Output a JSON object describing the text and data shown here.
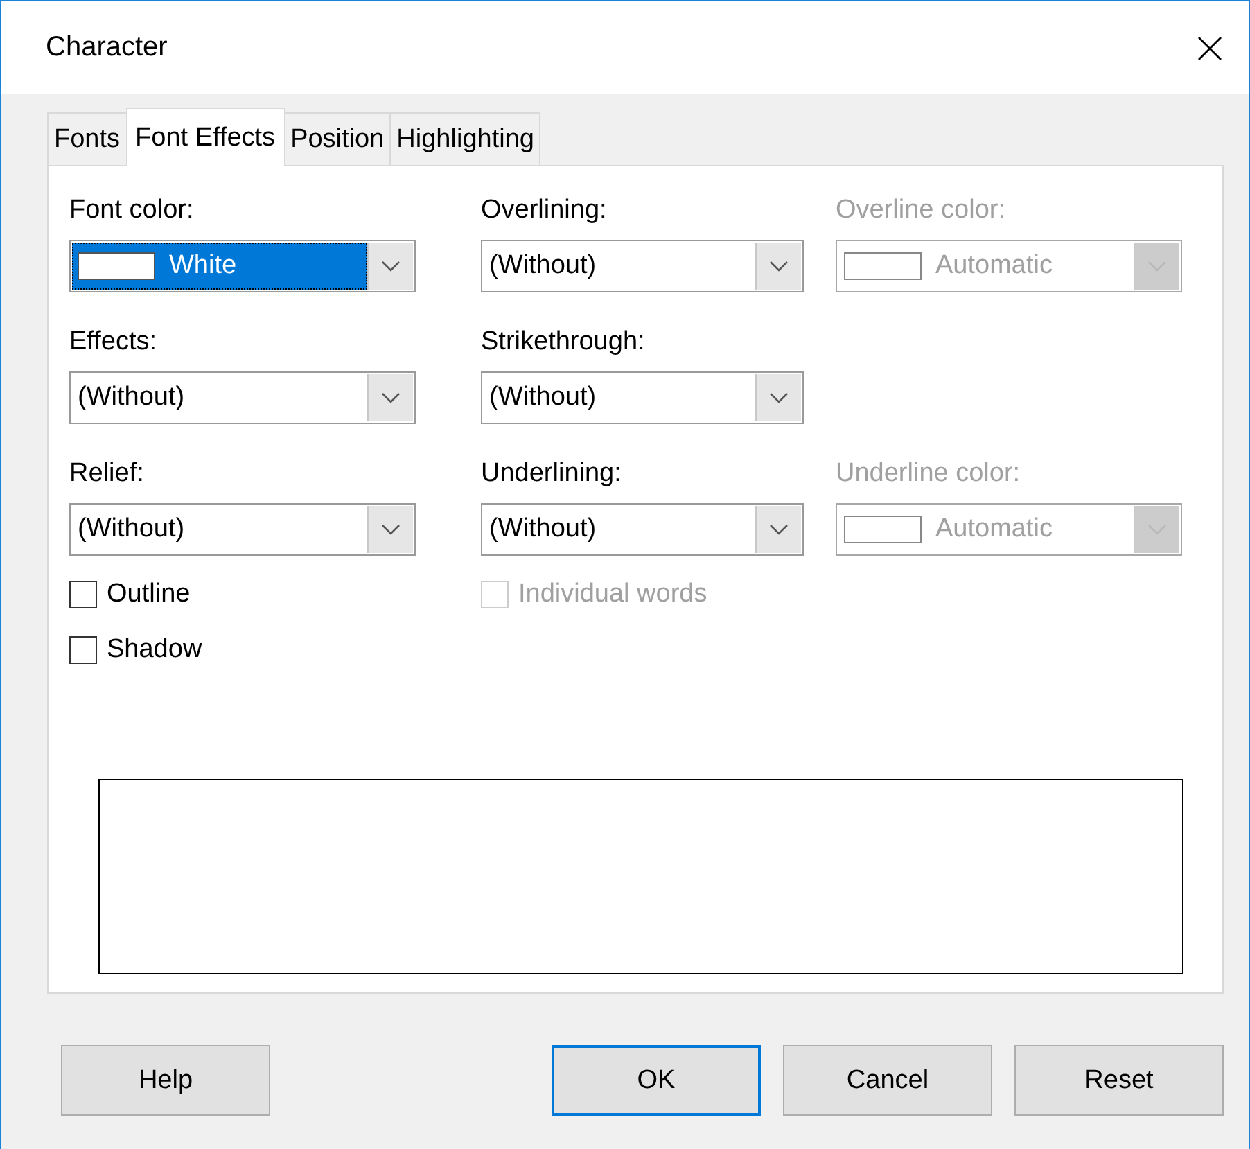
{
  "window": {
    "title": "Character"
  },
  "tabs": [
    {
      "label": "Fonts",
      "selected": false
    },
    {
      "label": "Font Effects",
      "selected": true
    },
    {
      "label": "Position",
      "selected": false
    },
    {
      "label": "Highlighting",
      "selected": false
    }
  ],
  "rows": [
    {
      "cells": [
        {
          "kind": "color_dropdown",
          "label": "Font color:",
          "value": "White",
          "color": "#ffffff",
          "focused": true,
          "disabled": false
        },
        {
          "kind": "dropdown",
          "label": "Overlining:",
          "value": "(Without)",
          "focused": false,
          "disabled": false
        },
        {
          "kind": "color_dropdown",
          "label": "Overline color:",
          "value": "Automatic",
          "color": "#ffffff",
          "focused": false,
          "disabled": true
        }
      ]
    },
    {
      "cells": [
        {
          "kind": "dropdown",
          "label": "Effects:",
          "value": "(Without)",
          "focused": false,
          "disabled": false
        },
        {
          "kind": "dropdown",
          "label": "Strikethrough:",
          "value": "(Without)",
          "focused": false,
          "disabled": false
        }
      ]
    },
    {
      "cells": [
        {
          "kind": "dropdown",
          "label": "Relief:",
          "value": "(Without)",
          "focused": false,
          "disabled": false
        },
        {
          "kind": "dropdown",
          "label": "Underlining:",
          "value": "(Without)",
          "focused": false,
          "disabled": false
        },
        {
          "kind": "color_dropdown",
          "label": "Underline color:",
          "value": "Automatic",
          "color": "#ffffff",
          "focused": false,
          "disabled": true
        }
      ]
    },
    {
      "cells": [
        {
          "kind": "checkbox",
          "label": "Outline",
          "checked": false,
          "disabled": false
        },
        {
          "kind": "checkbox",
          "label": "Individual words",
          "checked": false,
          "disabled": true
        }
      ]
    },
    {
      "cells": [
        {
          "kind": "checkbox",
          "label": "Shadow",
          "checked": false,
          "disabled": false
        }
      ]
    }
  ],
  "buttons": [
    {
      "label": "Help",
      "default": false
    },
    {
      "label": "OK",
      "default": true
    },
    {
      "label": "Cancel",
      "default": false
    },
    {
      "label": "Reset",
      "default": false
    }
  ]
}
